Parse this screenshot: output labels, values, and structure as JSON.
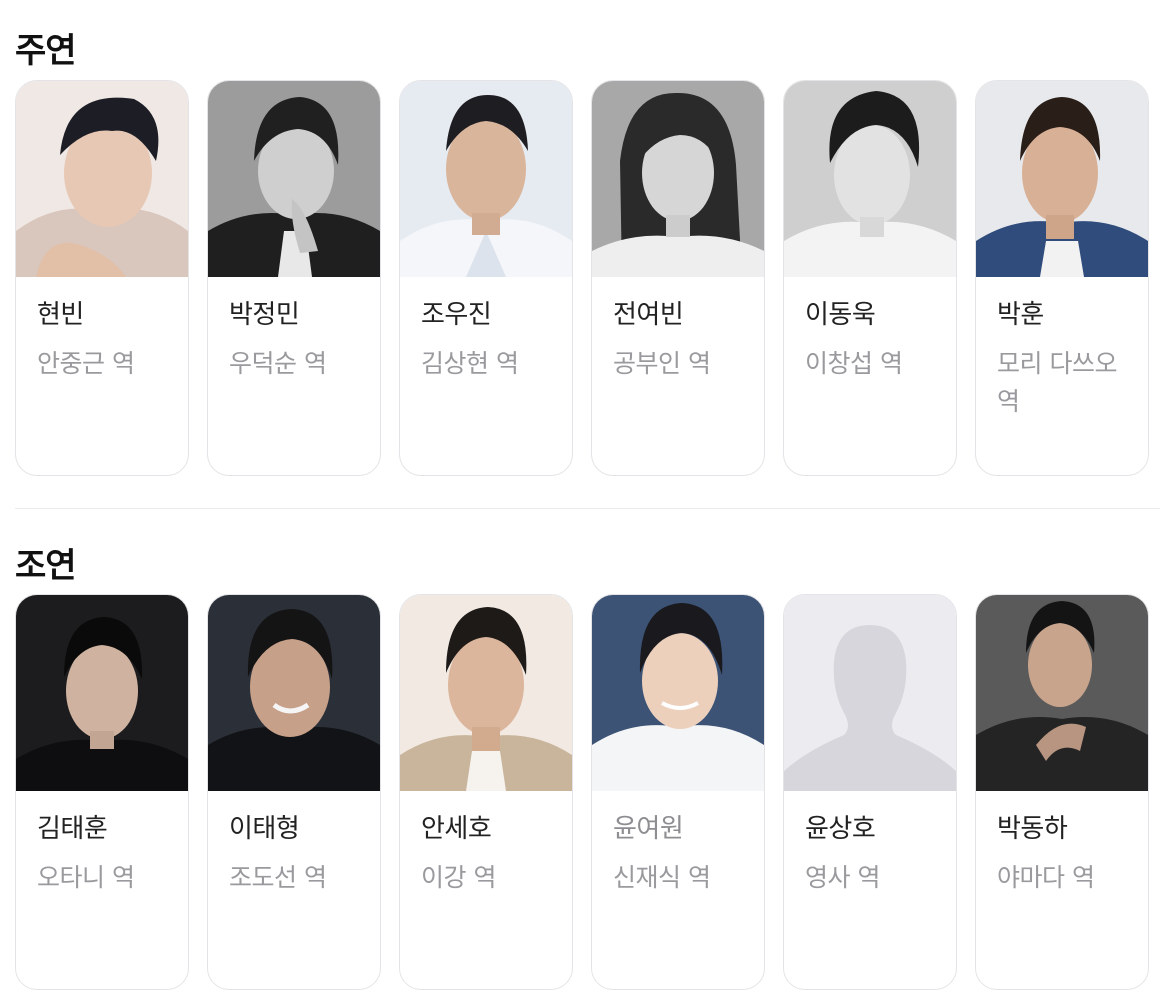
{
  "colors": {
    "card_border": "#e4e4e8",
    "name_text": "#222222",
    "role_text": "#9a9a9e",
    "placeholder_bg": "#ececf0",
    "placeholder_silhouette": "#d6d6dc"
  },
  "lead": {
    "title": "주연",
    "cast": [
      {
        "name": "현빈",
        "role": "안중근 역",
        "photo": "photo-color-light"
      },
      {
        "name": "박정민",
        "role": "우덕순 역",
        "photo": "photo-bw"
      },
      {
        "name": "조우진",
        "role": "김상현 역",
        "photo": "photo-color-light"
      },
      {
        "name": "전여빈",
        "role": "공부인 역",
        "photo": "photo-bw"
      },
      {
        "name": "이동욱",
        "role": "이창섭 역",
        "photo": "photo-bw"
      },
      {
        "name": "박훈",
        "role": "모리 다쓰오 역",
        "photo": "photo-color-blue"
      }
    ]
  },
  "supporting": {
    "title": "조연",
    "cast": [
      {
        "name": "김태훈",
        "role": "오타니 역",
        "photo": "photo-dark"
      },
      {
        "name": "이태형",
        "role": "조도선 역",
        "photo": "photo-dark"
      },
      {
        "name": "안세호",
        "role": "이강 역",
        "photo": "photo-color-light"
      },
      {
        "name": "윤여원",
        "role": "신재식 역",
        "photo": "photo-color-blue"
      },
      {
        "name": "윤상호",
        "role": "영사 역",
        "photo": "placeholder-silhouette"
      },
      {
        "name": "박동하",
        "role": "야마다 역",
        "photo": "photo-dark"
      }
    ]
  }
}
